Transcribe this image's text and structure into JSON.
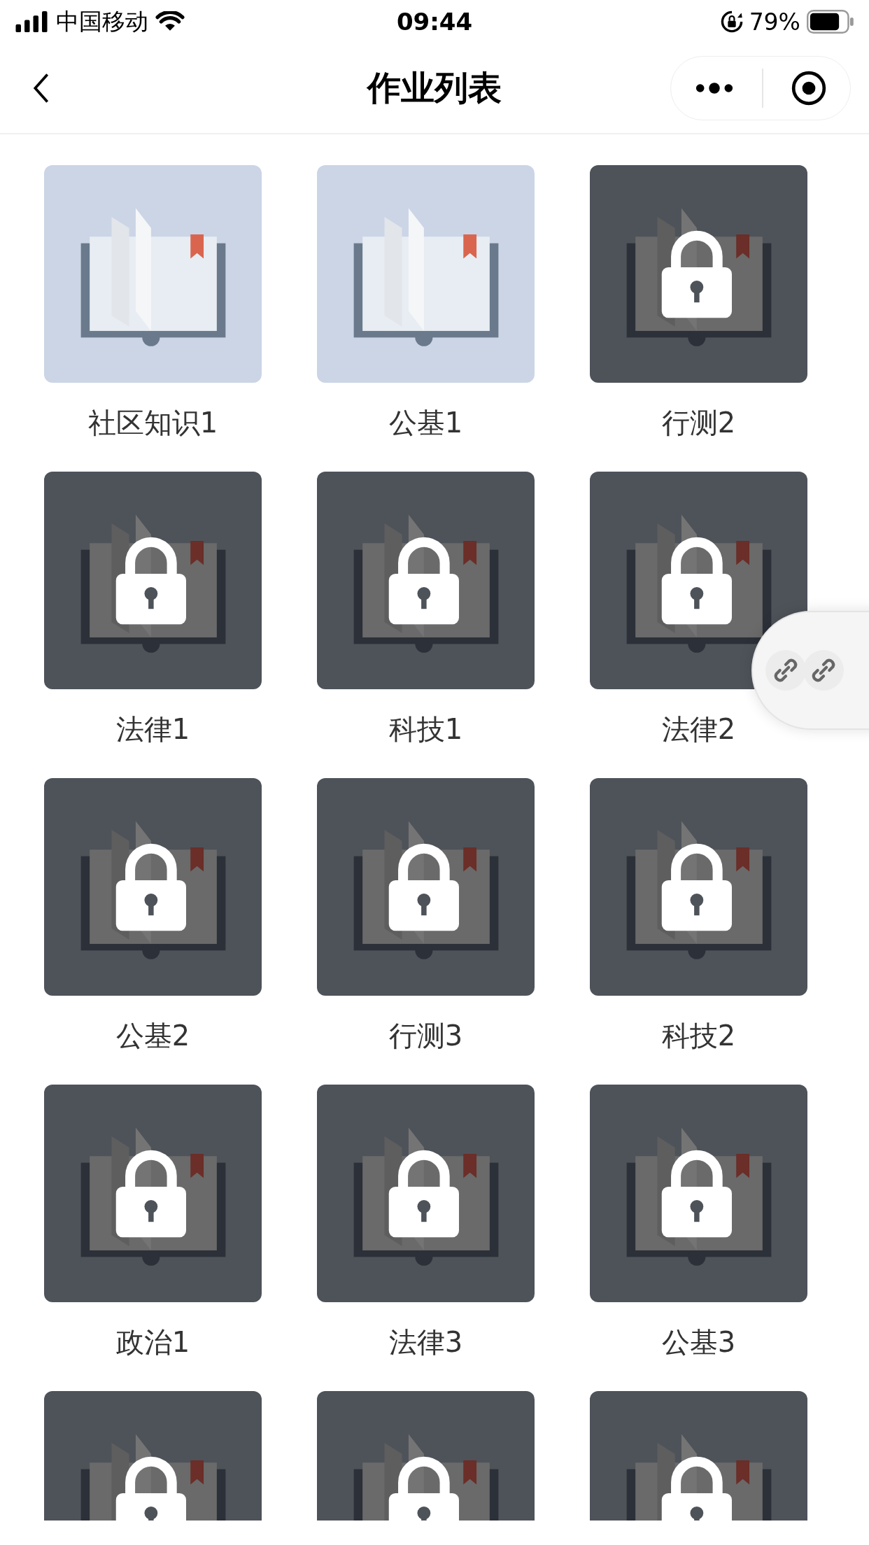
{
  "status_bar": {
    "carrier": "中国移动",
    "time": "09:44",
    "battery": "79%"
  },
  "nav_bar": {
    "title": "作业列表"
  },
  "tiles": [
    {
      "label": "社区知识1",
      "locked": false
    },
    {
      "label": "公基1",
      "locked": false
    },
    {
      "label": "行测2",
      "locked": true
    },
    {
      "label": "法律1",
      "locked": true
    },
    {
      "label": "科技1",
      "locked": true
    },
    {
      "label": "法律2",
      "locked": true
    },
    {
      "label": "公基2",
      "locked": true
    },
    {
      "label": "行测3",
      "locked": true
    },
    {
      "label": "科技2",
      "locked": true
    },
    {
      "label": "政治1",
      "locked": true
    },
    {
      "label": "法律3",
      "locked": true
    },
    {
      "label": "公基3",
      "locked": true
    },
    {
      "locked": true
    },
    {
      "locked": true
    },
    {
      "locked": true
    }
  ]
}
